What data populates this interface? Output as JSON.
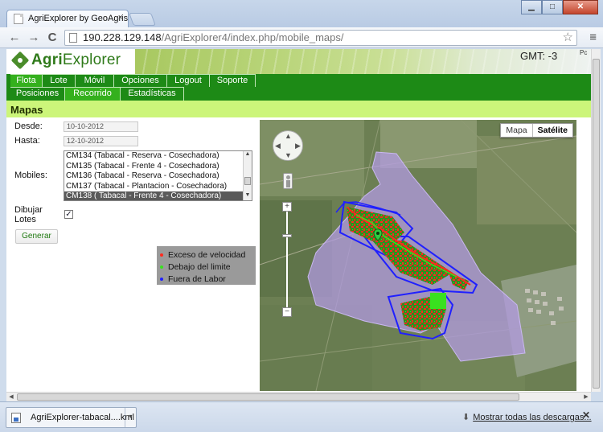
{
  "browser": {
    "tab_title": "AgriExplorer by GeoAgris",
    "tab_close": "×",
    "url_host": "190.228.129.148",
    "url_path": "/AgriExplorer4/index.php/mobile_maps/",
    "back": "←",
    "forward": "→",
    "reload": "C",
    "star": "☆",
    "menu": "≡",
    "window_controls": {
      "minimize": "▁",
      "maximize": "□",
      "close": "✕"
    }
  },
  "header": {
    "logo_agri": "Agri",
    "logo_explorer": "Explorer",
    "gmt": "GMT: -3",
    "corner_text": "Pc"
  },
  "nav_primary": [
    {
      "label": "Flota",
      "active": true
    },
    {
      "label": "Lote",
      "active": false
    },
    {
      "label": "Móvil",
      "active": false
    },
    {
      "label": "Opciones",
      "active": false
    },
    {
      "label": "Logout",
      "active": false
    },
    {
      "label": "Soporte",
      "active": false
    }
  ],
  "nav_secondary": [
    {
      "label": "Posiciones",
      "active": false
    },
    {
      "label": "Recorrido",
      "active": true
    },
    {
      "label": "Estadísticas",
      "active": false
    }
  ],
  "section": {
    "title": "Mapas"
  },
  "form": {
    "desde_label": "Desde:",
    "desde_value": "10-10-2012",
    "hasta_label": "Hasta:",
    "hasta_value": "12-10-2012",
    "mobiles_label": "Mobiles:",
    "mobiles_options": [
      "CM134 (Tabacal - Reserva - Cosechadora)",
      "CM135 (Tabacal - Frente 4 - Cosechadora)",
      "CM136 (Tabacal - Reserva - Cosechadora)",
      "CM137 (Tabacal - Plantacion - Cosechadora)",
      "CM138 ( Tabacal - Frente 4 - Cosechadora)"
    ],
    "mobiles_selected_index": 4,
    "dibujar_label_1": "Dibujar",
    "dibujar_label_2": "Lotes",
    "dibujar_checked": true,
    "checkbox_mark": "✓",
    "generar_button": "Generar"
  },
  "legend": {
    "items": [
      {
        "label": "Exceso de velocidad",
        "color": "#ff2a1f"
      },
      {
        "label": "Debajo del limite",
        "color": "#39e11f"
      },
      {
        "label": "Fuera de Labor",
        "color": "#2020ff"
      }
    ]
  },
  "map": {
    "type_map": "Mapa",
    "type_satellite": "Satélite",
    "zoom_in": "+",
    "zoom_out": "−",
    "pan_up": "▲",
    "pan_down": "▼",
    "pan_left": "◀",
    "pan_right": "▶",
    "field_color": "#b49be6",
    "route_colors": {
      "speeding": "#ff2a1f",
      "under_limit": "#39e11f",
      "off_labor": "#2020ff"
    }
  },
  "downloads": {
    "file_name": "AgriExplorer-tabacal....kml",
    "caret": "▾",
    "show_all": "Mostrar todas las descargas...",
    "download_icon": "⬇",
    "close": "✕"
  },
  "scroll": {
    "left_arrow": "◀",
    "right_arrow": "▶"
  }
}
